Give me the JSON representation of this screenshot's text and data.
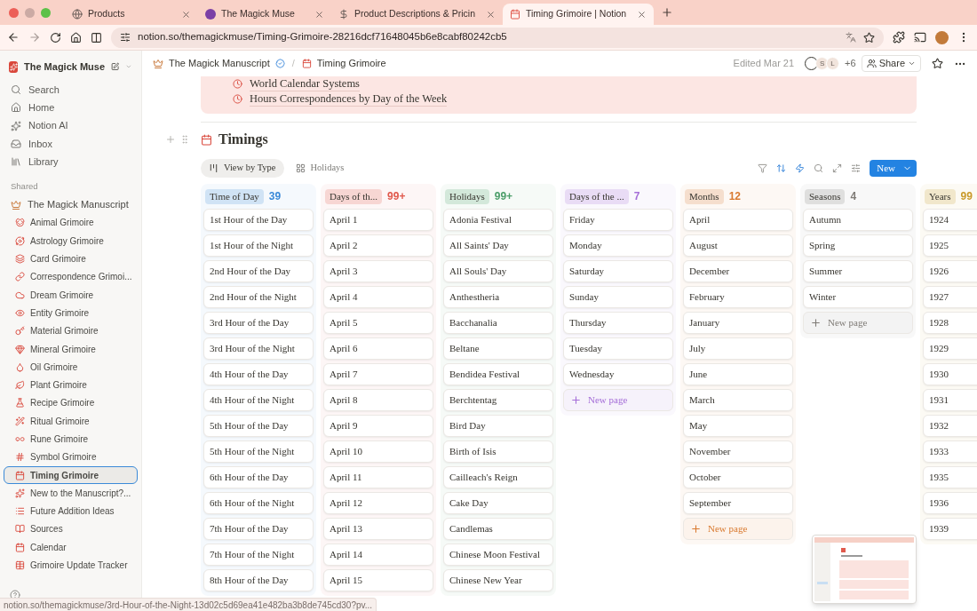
{
  "browser": {
    "tabs": [
      {
        "title": "Products",
        "selected": false
      },
      {
        "title": "The Magick Muse",
        "selected": false
      },
      {
        "title": "Product Descriptions & Pricin",
        "selected": false
      },
      {
        "title": "Timing Grimoire | Notion",
        "selected": true
      }
    ],
    "url": "notion.so/themagickmuse/Timing-Grimoire-28216dcf71648045b6e8cabf80242cb5"
  },
  "sidebar": {
    "workspace": "The Magick Muse",
    "nav": [
      "Search",
      "Home",
      "Notion AI",
      "Inbox",
      "Library"
    ],
    "section": "Shared",
    "root": {
      "label": "The Magick Manuscript",
      "children": [
        {
          "label": "Animal Grimoire",
          "selected": false
        },
        {
          "label": "Astrology Grimoire",
          "selected": false
        },
        {
          "label": "Card Grimoire",
          "selected": false
        },
        {
          "label": "Correspondence Grimoi...",
          "selected": false
        },
        {
          "label": "Dream Grimoire",
          "selected": false
        },
        {
          "label": "Entity Grimoire",
          "selected": false
        },
        {
          "label": "Material Grimoire",
          "selected": false
        },
        {
          "label": "Mineral Grimoire",
          "selected": false
        },
        {
          "label": "Oil Grimoire",
          "selected": false
        },
        {
          "label": "Plant Grimoire",
          "selected": false
        },
        {
          "label": "Recipe Grimoire",
          "selected": false
        },
        {
          "label": "Ritual Grimoire",
          "selected": false
        },
        {
          "label": "Rune Grimoire",
          "selected": false
        },
        {
          "label": "Symbol Grimoire",
          "selected": false
        },
        {
          "label": "Timing Grimoire",
          "selected": true
        },
        {
          "label": "New to the Manuscript?...",
          "selected": false
        },
        {
          "label": "Future Addition Ideas",
          "selected": false
        },
        {
          "label": "Sources",
          "selected": false
        },
        {
          "label": "Calendar",
          "selected": false
        },
        {
          "label": "Grimoire Update Tracker",
          "selected": false
        }
      ]
    }
  },
  "topbar": {
    "breadcrumb": [
      "The Magick Manuscript",
      "Timing Grimoire"
    ],
    "separator": "/",
    "edited": "Edited Mar 21",
    "avatars": [
      "S",
      "L"
    ],
    "more_people": "+6",
    "share": "Share"
  },
  "callout": {
    "items": [
      "World Calendar Systems",
      "Hours Correspondences by Day of the Week"
    ]
  },
  "database": {
    "title": "Timings",
    "views": [
      {
        "label": "View by Type",
        "selected": true
      },
      {
        "label": "Holidays",
        "selected": false
      }
    ],
    "new_button": "New",
    "columns": [
      {
        "name": "Time of Day",
        "count": "39",
        "color": "#3b8ad8",
        "cards": [
          "1st Hour of the Day",
          "1st Hour of the Night",
          "2nd Hour of the Day",
          "2nd Hour of the Night",
          "3rd Hour of the Day",
          "3rd Hour of the Night",
          "4th Hour of the Day",
          "4th Hour of the Night",
          "5th Hour of the Day",
          "5th Hour of the Night",
          "6th Hour of the Day",
          "6th Hour of the Night",
          "7th Hour of the Day",
          "7th Hour of the Night",
          "8th Hour of the Day"
        ]
      },
      {
        "name": "Days of th...",
        "count": "99+",
        "color": "#e0584c",
        "cards": [
          "April 1",
          "April 2",
          "April 3",
          "April 4",
          "April 5",
          "April 6",
          "April 7",
          "April 8",
          "April 9",
          "April 10",
          "April 11",
          "April 12",
          "April 13",
          "April 14",
          "April 15"
        ]
      },
      {
        "name": "Holidays",
        "count": "99+",
        "color": "#4c9e6a",
        "cards": [
          "Adonia Festival",
          "All Saints' Day",
          "All Souls' Day",
          "Anthestheria",
          "Bacchanalia",
          "Beltane",
          "Bendidea Festival",
          "Berchtentag",
          "Bird Day",
          "Birth of Isis",
          "Cailleach's Reign",
          "Cake Day",
          "Candlemas",
          "Chinese Moon Festival",
          "Chinese New Year"
        ]
      },
      {
        "name": "Days of the ...",
        "count": "7",
        "color": "#a56ed8",
        "cards": [
          "Friday",
          "Monday",
          "Saturday",
          "Sunday",
          "Thursday",
          "Tuesday",
          "Wednesday"
        ],
        "new_page": "New page"
      },
      {
        "name": "Months",
        "count": "12",
        "color": "#d97a30",
        "cards": [
          "April",
          "August",
          "December",
          "February",
          "January",
          "July",
          "June",
          "March",
          "May",
          "November",
          "October",
          "September"
        ],
        "new_page": "New page"
      },
      {
        "name": "Seasons",
        "count": "4",
        "color": "#7f7b76",
        "cards": [
          "Autumn",
          "Spring",
          "Summer",
          "Winter"
        ],
        "new_page": "New page"
      },
      {
        "name": "Years",
        "count": "99",
        "color": "#c99a2a",
        "cards": [
          "1924",
          "1925",
          "1926",
          "1927",
          "1928",
          "1929",
          "1930",
          "1931",
          "1932",
          "1933",
          "1935",
          "1936",
          "1939"
        ]
      }
    ]
  },
  "status_url": "notion.so/themagickmuse/3rd-Hour-of-the-Night-13d02c5d69ea41e482ba3b8de745cd30?pv..."
}
